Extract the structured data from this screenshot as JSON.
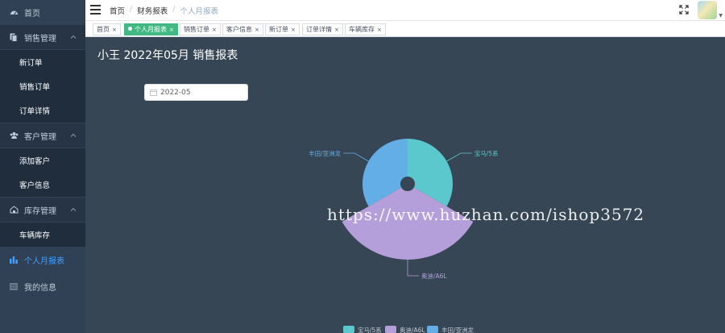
{
  "sidebar": {
    "items": [
      {
        "label": "首页",
        "icon": "dashboard-icon"
      },
      {
        "label": "销售管理",
        "icon": "documents-icon",
        "children": [
          "新订单",
          "销售订单",
          "订单详情"
        ]
      },
      {
        "label": "客户管理",
        "icon": "users-icon",
        "children": [
          "添加客户",
          "客户信息"
        ]
      },
      {
        "label": "库存管理",
        "icon": "warehouse-icon",
        "children": [
          "车辆库存"
        ]
      },
      {
        "label": "个人月报表",
        "icon": "bar-chart-icon",
        "active": true
      },
      {
        "label": "我的信息",
        "icon": "list-icon"
      }
    ]
  },
  "breadcrumb": [
    "首页",
    "财务报表",
    "个人月报表"
  ],
  "tags": [
    {
      "label": "首页",
      "active": false
    },
    {
      "label": "个人月报表",
      "active": true
    },
    {
      "label": "销售订单",
      "active": false
    },
    {
      "label": "客户信息",
      "active": false
    },
    {
      "label": "新订单",
      "active": false
    },
    {
      "label": "订单详情",
      "active": false
    },
    {
      "label": "车辆库存",
      "active": false
    }
  ],
  "main": {
    "title": "小王 2022年05月 销售报表",
    "date_value": "2022-05"
  },
  "watermark": "https://www.huzhan.com/ishop3572",
  "colors": {
    "sidebar_bg": "#304156",
    "main_bg": "#364654",
    "tag_active": "#42b983",
    "active_link": "#409eff"
  },
  "chart_data": {
    "type": "pie",
    "subtype": "rose",
    "categories": [
      "宝马/5系",
      "奥迪/A6L",
      "丰田/亚洲龙"
    ],
    "values": [
      1,
      2,
      1
    ],
    "colors": [
      "#5ac8cc",
      "#b59fdb",
      "#64aee8"
    ],
    "legend": [
      "宝马/5系",
      "奥迪/A6L",
      "丰田/亚洲龙"
    ],
    "legend_position": "bottom"
  }
}
